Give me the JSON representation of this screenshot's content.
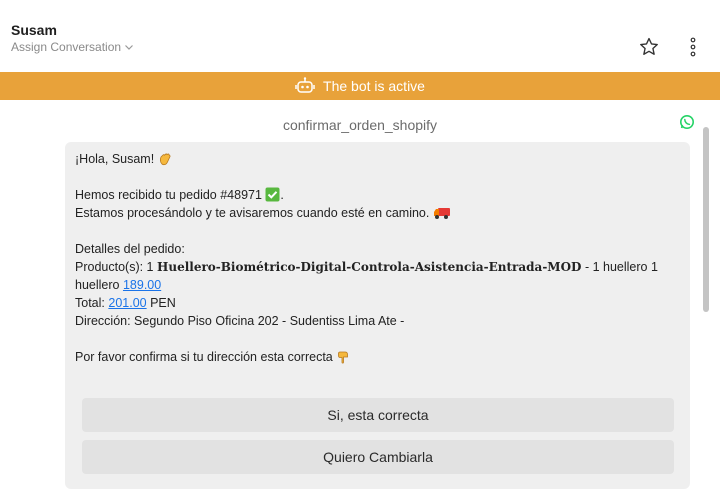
{
  "header": {
    "contact_name": "Susam",
    "assign_label": "Assign Conversation"
  },
  "bot_banner": {
    "text": "The bot is active",
    "color": "#e8a23a"
  },
  "message": {
    "template_name": "confirmar_orden_shopify",
    "greeting": "¡Hola, Susam!",
    "received_prefix": "Hemos recibido tu pedido #48971",
    "received_suffix": ".",
    "processing": "Estamos procesándolo y te avisaremos cuando esté en camino.",
    "details_heading": "Detalles del pedido:",
    "product_prefix": "Producto(s): 1",
    "product_name": "Huellero-Biométrico-Digital-Controla-Asistencia-Entrada-MOD",
    "product_suffix": "- 1 huellero 1",
    "product_line2": "huellero",
    "product_price": "189.00",
    "total_label": "Total:",
    "total_amount": "201.00",
    "currency": "PEN",
    "address": "Dirección: Segundo Piso Oficina 202 - Sudentiss Lima Ate -",
    "confirm_prompt": "Por favor confirma si tu dirección esta correcta"
  },
  "buttons": {
    "confirm": "Si, esta correcta",
    "change": "Quiero Cambiarla"
  },
  "icons": [
    "chevron-down-icon",
    "star-icon",
    "more-vertical-icon",
    "robot-icon",
    "whatsapp-icon"
  ]
}
